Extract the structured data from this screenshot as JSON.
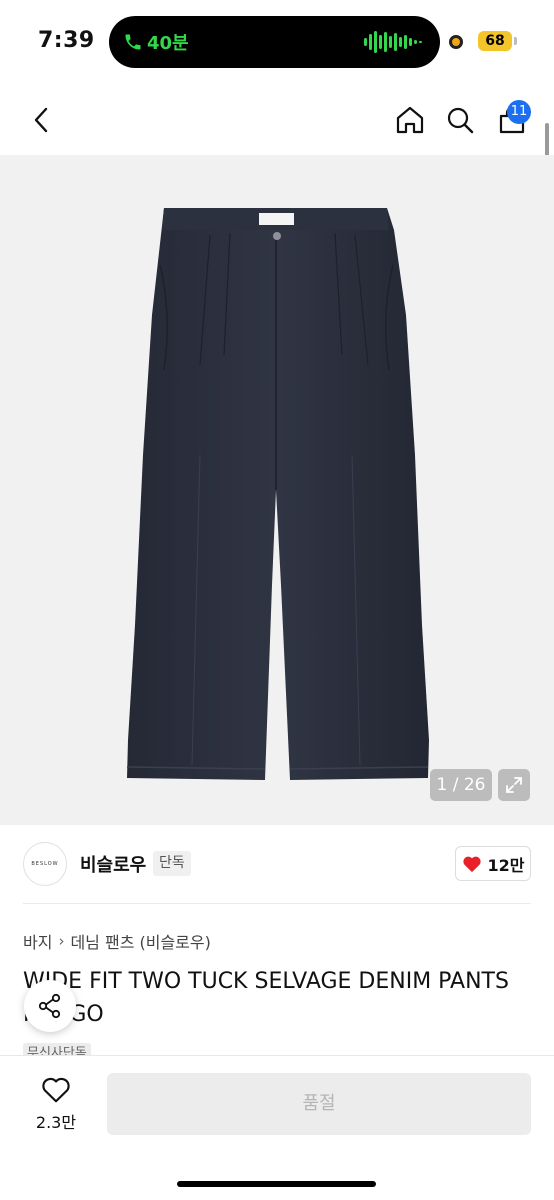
{
  "status_bar": {
    "time": "7:39",
    "call_duration": "40분",
    "battery": "68"
  },
  "nav": {
    "cart_count": "11",
    "icons": [
      "back-icon",
      "home-icon",
      "search-icon",
      "cart-icon"
    ]
  },
  "gallery": {
    "counter": "1 / 26"
  },
  "brand": {
    "logo_text": "BESLOW",
    "name": "비슬로우",
    "tag": "단독",
    "likes": "12만"
  },
  "breadcrumb": {
    "category": "바지",
    "subcategory": "데님 팬츠 (비슬로우)"
  },
  "product": {
    "title": "WIDE FIT TWO TUCK SELVAGE DENIM PANTS INDIGO",
    "badge": "무신사단독"
  },
  "bottom_bar": {
    "wish_count": "2.3만",
    "buy_button": "품절"
  },
  "colors": {
    "accent": "#1d6ff2",
    "heart": "#e8202a",
    "call_green": "#32d74b",
    "denim": "#2b2f3c"
  }
}
